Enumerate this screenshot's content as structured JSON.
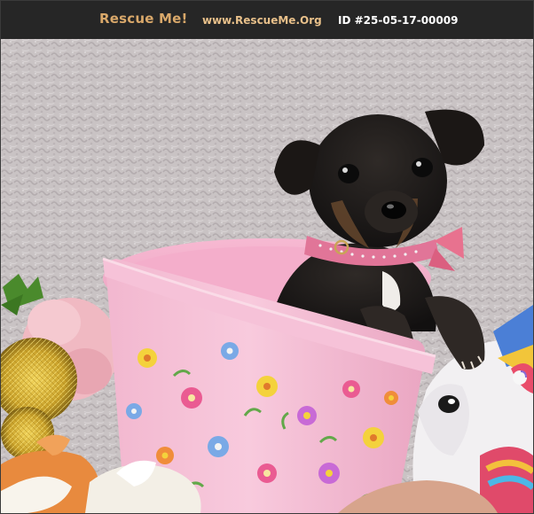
{
  "header": {
    "brand_label": "Rescue Me!",
    "site_label": "www.RescueMe.Org",
    "id_label": "ID #25-05-17-00009"
  },
  "colors": {
    "header_bg": "#262626",
    "brand": "#d9a86a",
    "site": "#e8c08a",
    "id_text": "#ffffff"
  },
  "photo": {
    "subject": "puppy-in-pink-flower-bucket"
  }
}
